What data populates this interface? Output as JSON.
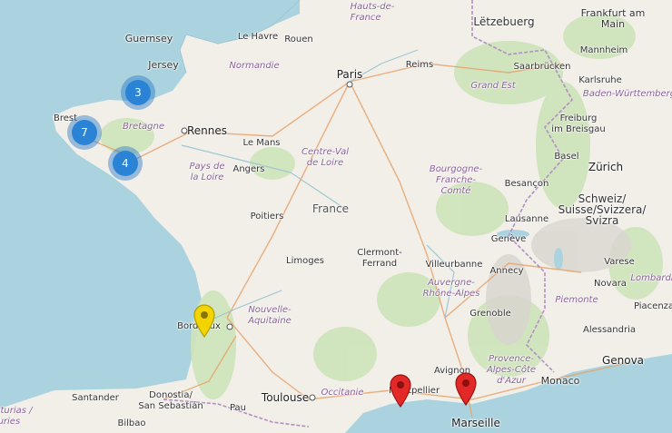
{
  "map": {
    "labels": {
      "haut_de_france": "Hauts-de-\nFrance",
      "guernsey": "Guernsey",
      "jersey": "Jersey",
      "le_havre": "Le Havre",
      "rouen": "Rouen",
      "normandie": "Normandie",
      "paris": "Paris",
      "reims": "Reims",
      "letzebuerg": "Lëtzebuerg",
      "frankfurt": "Frankfurt am\nMain",
      "mannheim": "Mannheim",
      "saarbrucken": "Saarbrücken",
      "karlsruhe": "Karlsruhe",
      "baden": "Baden-Württemberg",
      "grand_est": "Grand Est",
      "brest": "Brest",
      "bretagne": "Bretagne",
      "rennes": "Rennes",
      "le_mans": "Le Mans",
      "centre": "Centre-Val\nde Loire",
      "freiburg": "Freiburg\nim Breisgau",
      "pays_loire": "Pays de\nla Loire",
      "angers": "Angers",
      "bourgogne": "Bourgogne-\nFranche-\nComté",
      "basel": "Basel",
      "zurich": "Zürich",
      "besancon": "Besançon",
      "schweiz": "Schweiz/\nSuisse/Svizzera/\nSvizra",
      "poitiers": "Poitiers",
      "france": "France",
      "lausanne": "Lausanne",
      "geneve": "Genève",
      "clermont": "Clermont-\nFerrand",
      "limoges": "Limoges",
      "villeurbanne": "Villeurbanne",
      "annecy": "Annecy",
      "varese": "Varese",
      "lombardia": "Lombardi",
      "novara": "Novara",
      "auvergne": "Auvergne-\nRhône-Alpes",
      "piemonte": "Piemonte",
      "piacenza": "Piacenza",
      "nouvelle_aquitaine": "Nouvelle-\nAquitaine",
      "grenoble": "Grenoble",
      "alessandria": "Alessandria",
      "bordeaux": "Bordeaux",
      "genova": "Genova",
      "paca": "Provence-\nAlpes-Côte\nd'Azur",
      "avignon": "Avignon",
      "monaco": "Monaco",
      "santander": "Santander",
      "donostia": "Donostia/\nSan Sebastián",
      "toulouse": "Toulouse",
      "occitanie": "Occitanie",
      "montpellier": "Montpellier",
      "asturies": "Asturias /\nsturies",
      "bilbao": "Bilbao",
      "pau": "Pau",
      "marseille": "Marseille"
    },
    "clusters": [
      {
        "count": "3"
      },
      {
        "count": "7"
      },
      {
        "count": "4"
      }
    ],
    "markers": [
      {
        "color": "#f2d400",
        "place": "Bordeaux"
      },
      {
        "color": "#e32828",
        "place": "Montpellier"
      },
      {
        "color": "#e32828",
        "place": "Marseille"
      }
    ],
    "colors": {
      "sea": "#aad3df",
      "land": "#f2efe9",
      "forest": "#cde3b9",
      "cluster": "#2b83d6"
    }
  }
}
